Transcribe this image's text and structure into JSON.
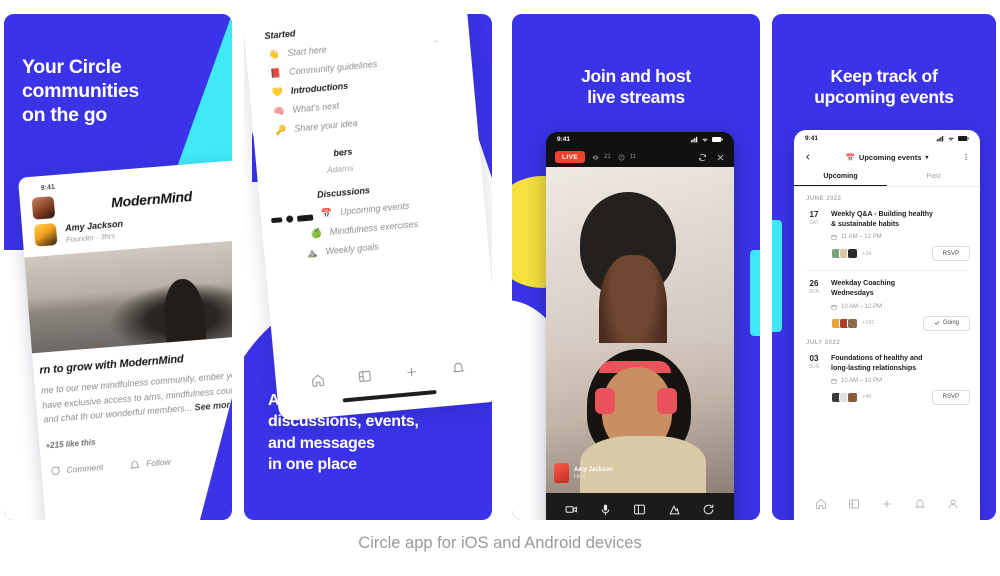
{
  "caption": "Circle app for iOS and Android devices",
  "colors": {
    "brand_blue": "#3A33E8",
    "cyan": "#3FE9F7",
    "pink": "#FBC3CD",
    "yellow": "#F6E13F",
    "live_red": "#F0402F",
    "caption_grey": "#9A9A9A"
  },
  "panels": [
    {
      "id": "panel-1",
      "headline": "Your Circle\ncommunities\non the go",
      "card": {
        "status_time": "9:41",
        "community_name": "ModernMind",
        "author_name": "Amy Jackson",
        "author_meta": "Founder · 3hrs",
        "post_title": "rn to grow with ModernMind",
        "post_body": "me to our new mindfulness community, ember you will have exclusive access to ams, mindfulness courses and chat th our wonderful members...",
        "see_more": "See more",
        "likes": "+215 like this",
        "action_comment": "Comment",
        "action_follow": "Follow"
      }
    },
    {
      "id": "panel-2",
      "headline": "All your\ndiscussions, events,\nand messages\nin one place",
      "sheet": {
        "section_started": "Started",
        "items_started": [
          {
            "emoji": "👋",
            "label": "Start here",
            "bold": false
          },
          {
            "emoji": "📕",
            "label": "Community guidelines",
            "bold": false
          },
          {
            "emoji": "💛",
            "label": "Introductions",
            "bold": true
          },
          {
            "emoji": "🧠",
            "label": "What's next",
            "bold": false
          },
          {
            "emoji": "🔑",
            "label": "Share your idea",
            "bold": false
          }
        ],
        "section_members": "bers",
        "members_dim": "Adams",
        "section_discussions": "Discussions",
        "items_discussions": [
          {
            "emoji": "📅",
            "label": "Upcoming events",
            "bold": false
          },
          {
            "emoji": "🍏",
            "label": "Mindfulness exercises",
            "bold": false
          },
          {
            "emoji": "⛰️",
            "label": "Weekly goals",
            "bold": false
          }
        ],
        "nav": [
          "home-icon",
          "spaces-icon",
          "plus-icon",
          "bell-icon"
        ]
      }
    },
    {
      "id": "panel-3",
      "headline": "Join and host\nlive streams",
      "phone": {
        "status_time": "9:41",
        "live_badge": "LIVE",
        "viewers": "21",
        "duration": "11",
        "speaker_name": "Amy Jackson",
        "speaker_role": "Host",
        "tools": [
          "camera-icon",
          "microphone-icon",
          "layout-icon",
          "share-icon",
          "switch-camera-icon"
        ]
      }
    },
    {
      "id": "panel-4",
      "headline": "Keep track of\nupcoming events",
      "phone": {
        "status_time": "9:41",
        "title": "Upcoming events",
        "title_emoji": "📅",
        "tabs": [
          {
            "label": "Upcoming",
            "active": true
          },
          {
            "label": "Past",
            "active": false
          }
        ],
        "groups": [
          {
            "month": "JUNE 2022",
            "events": [
              {
                "day": "17",
                "dow": "SAT",
                "title": "Weekly Q&A - Building healthy\n& sustainable habits",
                "time": "11 AM – 12 PM",
                "extra_count": "+24",
                "action": "RSVP",
                "action_state": "rsvp"
              },
              {
                "day": "26",
                "dow": "SUN",
                "title": "Weekday Coaching\nWednesdays",
                "time": "10 AM – 12 PM",
                "extra_count": "+141",
                "action": "Going",
                "action_state": "going"
              }
            ]
          },
          {
            "month": "JULY 2022",
            "events": [
              {
                "day": "03",
                "dow": "SUN",
                "title": "Foundations of healthy and\nlong-lasting relationships",
                "time": "10 AM – 12 PM",
                "extra_count": "+48",
                "action": "RSVP",
                "action_state": "rsvp"
              }
            ]
          }
        ],
        "nav": [
          "home-icon",
          "spaces-icon",
          "plus-icon",
          "bell-icon",
          "profile-icon"
        ]
      }
    }
  ]
}
